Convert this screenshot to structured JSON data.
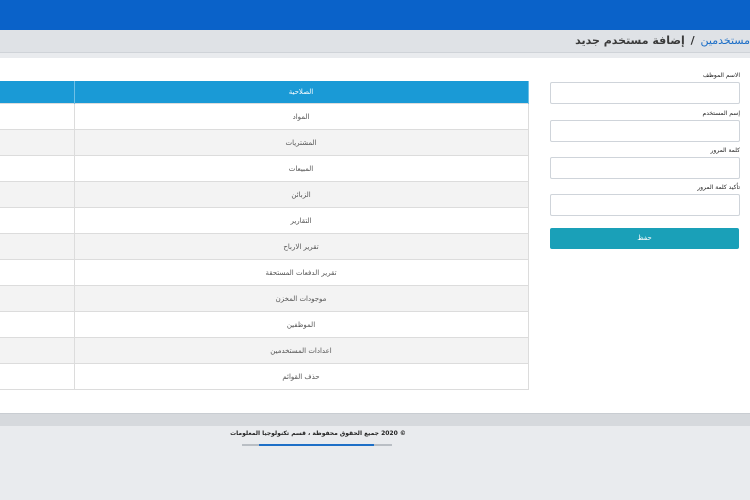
{
  "breadcrumb": {
    "link": "مستخدمين",
    "separator": "/",
    "current": "إضافة مستخدم جديد"
  },
  "form": {
    "employee_name_label": "الاسم الموظف",
    "username_label": "إسم المستخدم",
    "password_label": "كلمة المرور",
    "confirm_password_label": "تأكيد كلمة المرور",
    "save_label": "حفظ"
  },
  "permissions_table": {
    "header": "الصلاحية",
    "rows": [
      "المواد",
      "المشتريات",
      "المبيعات",
      "الزبائن",
      "التقارير",
      "تقرير الارباح",
      "تقرير الدفعات المستحقة",
      "موجودات المخزن",
      "الموظفين",
      "اعدادات المستخدمين",
      "حذف القوائم"
    ]
  },
  "footer": {
    "text": "© 2020 جميع الحقوق محفوظة ، قسم تكنولوجيا المعلومات"
  },
  "colors": {
    "topbar": "#0a62c9",
    "table_header": "#1a9ad6",
    "save_button": "#1aa0b8",
    "link": "#1d6fc7"
  }
}
